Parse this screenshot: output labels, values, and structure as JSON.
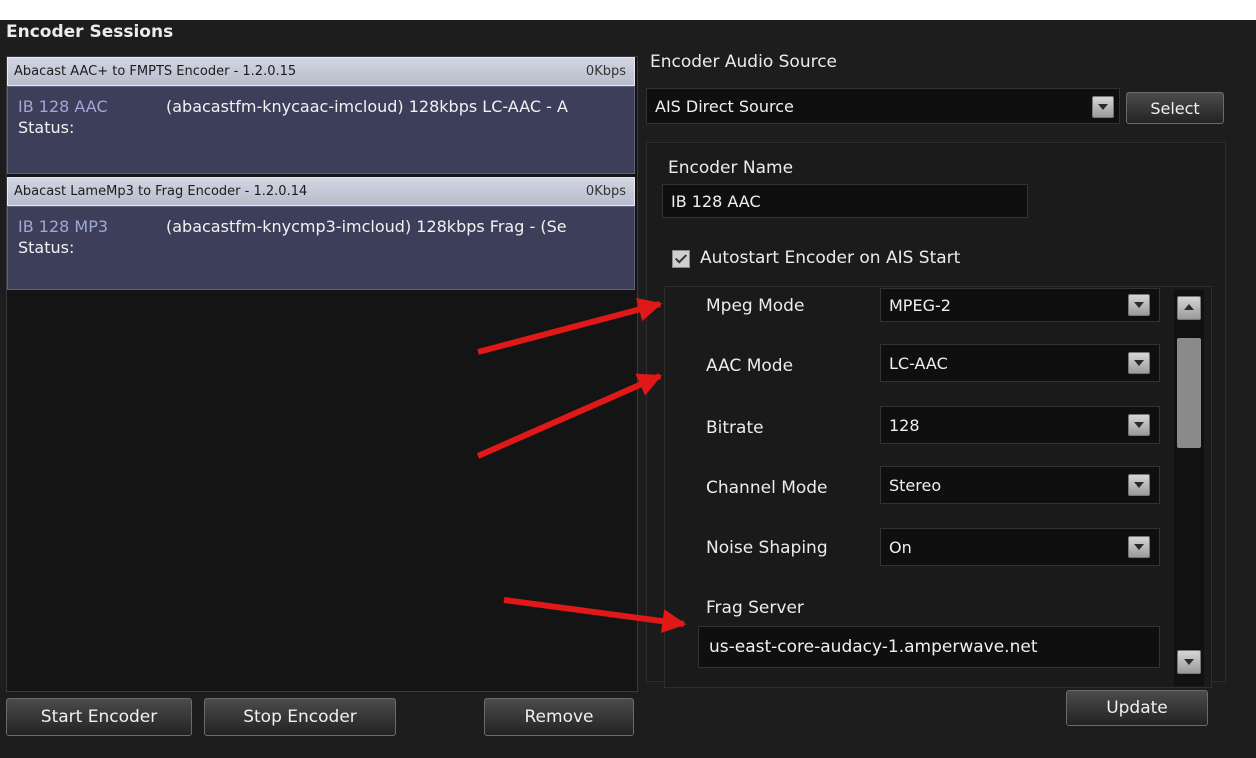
{
  "header": {
    "title": "Encoder Sessions"
  },
  "sessions": [
    {
      "header_name": "Abacast AAC+ to FMPTS Encoder - 1.2.0.15",
      "rate": "0Kbps",
      "name": "IB 128 AAC",
      "desc": "(abacastfm-knycaac-imcloud) 128kbps LC-AAC - A",
      "status": "Status:"
    },
    {
      "header_name": "Abacast LameMp3 to Frag Encoder - 1.2.0.14",
      "rate": "0Kbps",
      "name": "IB 128 MP3",
      "desc": "(abacastfm-knycmp3-imcloud) 128kbps Frag - (Se",
      "status": "Status:"
    }
  ],
  "buttons": {
    "start": "Start Encoder",
    "stop": "Stop Encoder",
    "remove": "Remove",
    "select": "Select",
    "update": "Update"
  },
  "audio_source": {
    "label": "Encoder Audio Source",
    "value": "AIS Direct Source"
  },
  "encoder_name": {
    "label": "Encoder Name",
    "value": "IB 128 AAC"
  },
  "autostart": {
    "label": "Autostart Encoder on AIS Start",
    "checked": true
  },
  "settings": {
    "mpeg_mode": {
      "label": "Mpeg Mode",
      "value": "MPEG-2"
    },
    "aac_mode": {
      "label": "AAC Mode",
      "value": "LC-AAC"
    },
    "bitrate": {
      "label": "Bitrate",
      "value": "128"
    },
    "channel_mode": {
      "label": "Channel Mode",
      "value": "Stereo"
    },
    "noise_shaping": {
      "label": "Noise Shaping",
      "value": "On"
    },
    "frag_server": {
      "label": "Frag Server",
      "value": "us-east-core-audacy-1.amperwave.net"
    }
  },
  "annotation_color": "#e01818"
}
